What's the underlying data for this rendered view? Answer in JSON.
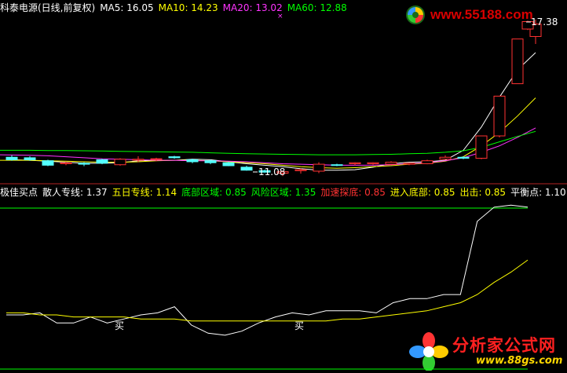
{
  "colors": {
    "background": "#000000",
    "up_candle": "#ff3232",
    "down_candle": "#54ffff",
    "ma5": "#ffffff",
    "ma10": "#ffff00",
    "ma20": "#ff33ff",
    "ma60": "#00ff00",
    "separator": "#b22222",
    "watermark_red": "#ff0000",
    "watermark_yellow": "#ffd700"
  },
  "main_header": {
    "title": "科泰电源(日线,前复权)",
    "ma5": "MA5: 16.05",
    "ma10": "MA10: 14.23",
    "ma20": "MA20: 13.02",
    "ma60": "MA60: 12.88"
  },
  "price_labels": {
    "high": "17.38",
    "low": "11.08"
  },
  "indicator_header": {
    "name": "极佳买点",
    "retail_line": "散人专线: 1.37",
    "five_day_line": "五日专线: 1.14",
    "bottom_zone": "底部区域: 0.85",
    "risk_zone": "风险区域: 1.35",
    "accelerate_bottom": "加速探底: 0.85",
    "enter_bottom": "进入底部: 0.85",
    "exit": "出击: 0.85",
    "balance_point": "平衡点: 1.10"
  },
  "signals": {
    "buy_1": "买",
    "buy_2": "买"
  },
  "watermarks": {
    "top_site": "www.55188.com",
    "bottom_title": "分析家公式网",
    "bottom_site": "www.88gs.com"
  },
  "chart_data": [
    {
      "type": "candlestick",
      "series": [
        {
          "name": "MA5",
          "values": [
            11.74,
            11.72,
            11.68,
            11.64,
            11.6,
            11.6,
            11.62,
            11.7,
            11.71,
            11.72,
            11.76,
            11.74,
            11.66,
            11.58,
            11.52,
            11.46,
            11.38,
            11.32,
            11.32,
            11.34,
            11.44,
            11.58,
            11.64,
            11.66,
            11.72,
            12.12,
            13.06,
            14.26,
            15.36,
            16.05
          ]
        },
        {
          "name": "MA10",
          "values": [
            11.72,
            11.72,
            11.7,
            11.68,
            11.66,
            11.64,
            11.64,
            11.66,
            11.7,
            11.72,
            11.72,
            11.7,
            11.66,
            11.62,
            11.58,
            11.52,
            11.46,
            11.42,
            11.4,
            11.42,
            11.46,
            11.5,
            11.56,
            11.6,
            11.68,
            11.86,
            12.3,
            12.84,
            13.5,
            14.23
          ]
        },
        {
          "name": "MA20",
          "values": [
            11.94,
            11.92,
            11.9,
            11.86,
            11.82,
            11.78,
            11.76,
            11.74,
            11.72,
            11.72,
            11.7,
            11.7,
            11.68,
            11.66,
            11.62,
            11.58,
            11.56,
            11.54,
            11.52,
            11.52,
            11.52,
            11.54,
            11.58,
            11.62,
            11.7,
            11.82,
            12.04,
            12.3,
            12.64,
            13.02
          ]
        },
        {
          "name": "MA60",
          "values": [
            12.12,
            12.12,
            12.11,
            12.11,
            12.1,
            12.09,
            12.08,
            12.07,
            12.06,
            12.05,
            12.04,
            12.02,
            12.0,
            11.98,
            11.97,
            11.96,
            11.95,
            11.94,
            11.94,
            11.94,
            11.95,
            11.96,
            11.98,
            12.0,
            12.04,
            12.1,
            12.24,
            12.46,
            12.68,
            12.88
          ]
        }
      ],
      "candles": [
        {
          "o": 11.84,
          "h": 11.92,
          "l": 11.7,
          "c": 11.74
        },
        {
          "o": 11.82,
          "h": 11.88,
          "l": 11.7,
          "c": 11.74
        },
        {
          "o": 11.7,
          "h": 11.74,
          "l": 11.48,
          "c": 11.52
        },
        {
          "o": 11.58,
          "h": 11.66,
          "l": 11.52,
          "c": 11.62
        },
        {
          "o": 11.6,
          "h": 11.64,
          "l": 11.48,
          "c": 11.56
        },
        {
          "o": 11.74,
          "h": 11.78,
          "l": 11.56,
          "c": 11.6
        },
        {
          "o": 11.54,
          "h": 11.8,
          "l": 11.5,
          "c": 11.76
        },
        {
          "o": 11.72,
          "h": 11.88,
          "l": 11.64,
          "c": 11.76
        },
        {
          "o": 11.76,
          "h": 11.82,
          "l": 11.68,
          "c": 11.78
        },
        {
          "o": 11.86,
          "h": 11.9,
          "l": 11.78,
          "c": 11.82
        },
        {
          "o": 11.74,
          "h": 11.78,
          "l": 11.6,
          "c": 11.66
        },
        {
          "o": 11.7,
          "h": 11.74,
          "l": 11.56,
          "c": 11.62
        },
        {
          "o": 11.62,
          "h": 11.66,
          "l": 11.48,
          "c": 11.5
        },
        {
          "o": 11.44,
          "h": 11.5,
          "l": 11.3,
          "c": 11.32
        },
        {
          "o": 11.3,
          "h": 11.34,
          "l": 11.22,
          "c": 11.24
        },
        {
          "o": 11.2,
          "h": 11.3,
          "l": 11.08,
          "c": 11.26
        },
        {
          "o": 11.3,
          "h": 11.4,
          "l": 11.18,
          "c": 11.34
        },
        {
          "o": 11.28,
          "h": 11.64,
          "l": 11.2,
          "c": 11.56
        },
        {
          "o": 11.54,
          "h": 11.58,
          "l": 11.48,
          "c": 11.52
        },
        {
          "o": 11.58,
          "h": 11.64,
          "l": 11.52,
          "c": 11.62
        },
        {
          "o": 11.58,
          "h": 11.64,
          "l": 11.54,
          "c": 11.62
        },
        {
          "o": 11.56,
          "h": 11.68,
          "l": 11.54,
          "c": 11.64
        },
        {
          "o": 11.56,
          "h": 11.62,
          "l": 11.52,
          "c": 11.6
        },
        {
          "o": 11.58,
          "h": 11.74,
          "l": 11.56,
          "c": 11.7
        },
        {
          "o": 11.76,
          "h": 11.92,
          "l": 11.74,
          "c": 11.84
        },
        {
          "o": 11.84,
          "h": 11.88,
          "l": 11.76,
          "c": 11.8
        },
        {
          "o": 11.8,
          "h": 12.7,
          "l": 11.76,
          "c": 12.7
        },
        {
          "o": 12.7,
          "h": 14.3,
          "l": 12.64,
          "c": 14.3
        },
        {
          "o": 14.8,
          "h": 16.6,
          "l": 14.8,
          "c": 16.6
        },
        {
          "o": 16.7,
          "h": 17.38,
          "l": 16.4,
          "c": 17.2
        }
      ],
      "extra_candle": {
        "o": 17.0,
        "h": 17.34,
        "l": 16.96,
        "c": 17.3
      },
      "ylim": [
        10.9,
        17.6
      ]
    },
    {
      "type": "line",
      "series": [
        {
          "name": "散人专线",
          "values": [
            0.87,
            0.87,
            0.88,
            0.83,
            0.83,
            0.86,
            0.83,
            0.85,
            0.87,
            0.88,
            0.91,
            0.82,
            0.78,
            0.77,
            0.79,
            0.83,
            0.86,
            0.88,
            0.87,
            0.89,
            0.89,
            0.89,
            0.88,
            0.93,
            0.95,
            0.95,
            0.97,
            0.97,
            1.33,
            1.4,
            1.41,
            1.4
          ]
        },
        {
          "name": "五日专线",
          "values": [
            0.88,
            0.88,
            0.87,
            0.87,
            0.86,
            0.86,
            0.86,
            0.86,
            0.85,
            0.85,
            0.85,
            0.84,
            0.84,
            0.84,
            0.84,
            0.84,
            0.84,
            0.84,
            0.84,
            0.84,
            0.85,
            0.85,
            0.86,
            0.87,
            0.88,
            0.89,
            0.91,
            0.93,
            0.97,
            1.03,
            1.08,
            1.14
          ]
        }
      ],
      "ylim": [
        0.7,
        1.43
      ]
    }
  ]
}
